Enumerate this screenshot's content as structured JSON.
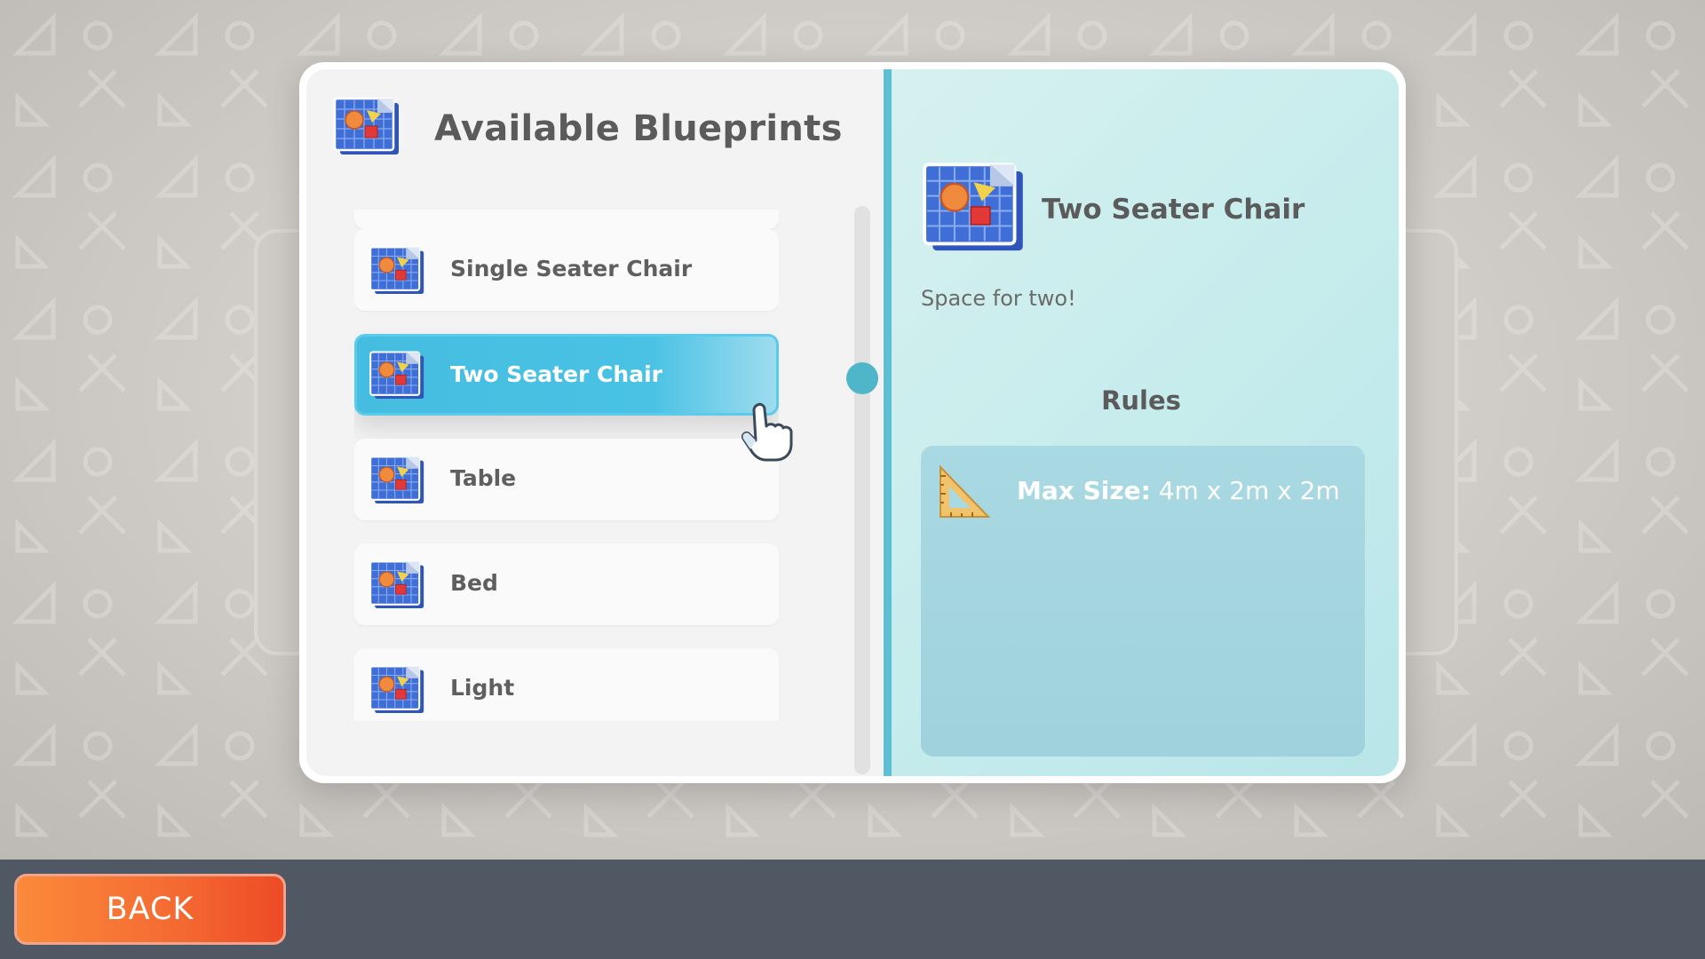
{
  "header": {
    "title": "Available Blueprints"
  },
  "blueprint_list": {
    "items": [
      {
        "label": "Single Seater Chair"
      },
      {
        "label": "Two Seater Chair",
        "selected": true
      },
      {
        "label": "Table"
      },
      {
        "label": "Bed"
      },
      {
        "label": "Light"
      }
    ]
  },
  "detail": {
    "title": "Two Seater Chair",
    "description": "Space for two!",
    "rules_heading": "Rules",
    "rules": [
      {
        "label": "Max Size:",
        "value": "4m x 2m x 2m",
        "icon": "ruler-triangle-icon"
      }
    ]
  },
  "footer": {
    "back_label": "BACK"
  },
  "colors": {
    "selected_item": "#47bfe2",
    "panel_accent": "#5cbfd4",
    "back_button": "#f46a32",
    "footer_bar": "#4f5863"
  }
}
